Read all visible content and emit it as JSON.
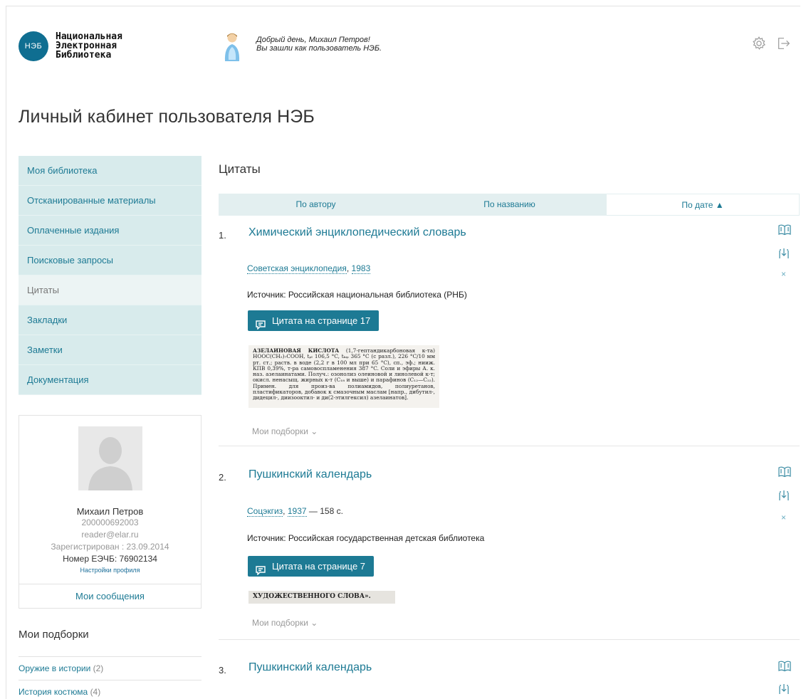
{
  "header": {
    "logo_abbr": "НЭБ",
    "logo_lines": [
      "Национальная",
      "Электронная",
      "Библиотека"
    ],
    "greeting_line1": "Добрый день, Михаил Петров!",
    "greeting_line2": "Вы зашли как пользователь НЭБ."
  },
  "page_title": "Личный кабинет пользователя НЭБ",
  "sidebar": {
    "items": [
      {
        "label": "Моя библиотека"
      },
      {
        "label": "Отсканированные материалы"
      },
      {
        "label": "Оплаченные издания"
      },
      {
        "label": "Поисковые запросы"
      },
      {
        "label": "Цитаты"
      },
      {
        "label": "Закладки"
      },
      {
        "label": "Заметки"
      },
      {
        "label": "Документация"
      }
    ],
    "active": "Цитаты"
  },
  "profile": {
    "name": "Михаил Петров",
    "id": "200000692003",
    "email": "reader@elar.ru",
    "registered": "Зарегистрирован : 23.09.2014",
    "card": "Номер ЕЭЧБ: 76902134",
    "settings_link": "Настройки профиля",
    "messages_link": "Мои сообщения"
  },
  "collections": {
    "title": "Мои подборки",
    "items": [
      {
        "label": "Оружие в истории",
        "count": "(2)"
      },
      {
        "label": "История костюма",
        "count": "(4)"
      }
    ]
  },
  "main": {
    "title": "Цитаты",
    "sort": {
      "by_author": "По автору",
      "by_title": "По названию",
      "by_date": "По дате ▲"
    },
    "entries": [
      {
        "num": "1.",
        "title": "Химический энциклопедический словарь",
        "publisher": "Советская энциклопедия",
        "year": "1983",
        "extra": "",
        "source": "Источник: Российская национальная библиотека (РНБ)",
        "quote_button": "Цитата на странице 17",
        "scan_heading": "АЗЕЛАИНОВАЯ КИСЛОТА",
        "scan_text": "(1,7-гептандикарбоновая к-та) HOOC(CH₂)₇COOH, tₚₗ 106,5 °C, tₖᵢₚ 365 °C (с разл.), 226 °C/10 мм рт. ст.; раств. в воде (2,2 г в 100 мл при 65 °C), сп., эф.; нииж. КПВ 0,39%, т-ра самовоспламенения 387 °C. Соли и эфиры А. к. наз. азелаинатами. Получ.: озонолиз олеиновой и линолевой к-т; окисл. ненасыщ. жирных к-т (C₁₈ и выше) и парафинов (C₁₂—C₂₂). Примен. для произ-ва полиамидов, полиуретанов, пластификаторов, добавок к смазочным маслам [напр., дибутил-, дидецил-, диизооктил- и ди(2-этилгексил) азелаинатов].",
        "collections_label": "Мои подборки"
      },
      {
        "num": "2.",
        "title": "Пушкинский календарь",
        "publisher": "Соцэкгиз",
        "year": "1937",
        "extra": " — 158 с.",
        "source": "Источник: Российская государственная детская библиотека",
        "quote_button": "Цитата на странице 7",
        "scan_heading": "ХУДОЖЕСТВЕННОГО СЛОВА».",
        "scan_text": "",
        "collections_label": "Мои подборки"
      },
      {
        "num": "3.",
        "title": "Пушкинский календарь"
      }
    ],
    "remove_glyph": "×"
  },
  "colors": {
    "accent": "#1d7a94",
    "sidebar_bg": "#d8ebec",
    "logo": "#0f6e91"
  }
}
